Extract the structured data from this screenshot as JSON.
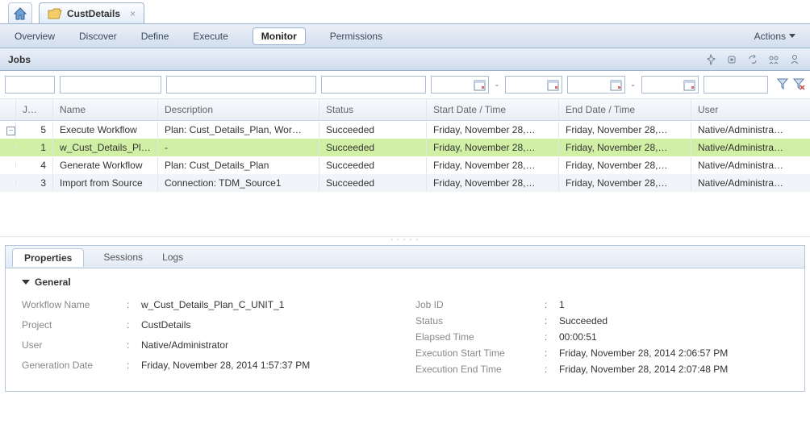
{
  "tabs": {
    "custdetails": "CustDetails"
  },
  "subnav": {
    "overview": "Overview",
    "discover": "Discover",
    "define": "Define",
    "execute": "Execute",
    "monitor": "Monitor",
    "permissions": "Permissions",
    "actions": "Actions"
  },
  "jobs_header": "Jobs",
  "grid": {
    "headers": {
      "job_id": "Job ID",
      "name": "Name",
      "description": "Description",
      "status": "Status",
      "start": "Start Date / Time",
      "end": "End Date / Time",
      "user": "User"
    },
    "rows": [
      {
        "id": "5",
        "name": "Execute Workflow",
        "desc": "Plan: Cust_Details_Plan, Wor…",
        "status": "Succeeded",
        "start": "Friday, November 28,…",
        "end": "Friday, November 28,…",
        "user": "Native/Administra…",
        "expand": true
      },
      {
        "id": "1",
        "name": "w_Cust_Details_Pl…",
        "desc": "-",
        "status": "Succeeded",
        "start": "Friday, November 28,…",
        "end": "Friday, November 28,…",
        "user": "Native/Administra…",
        "selected": true,
        "child": true
      },
      {
        "id": "4",
        "name": "Generate Workflow",
        "desc": "Plan: Cust_Details_Plan",
        "status": "Succeeded",
        "start": "Friday, November 28,…",
        "end": "Friday, November 28,…",
        "user": "Native/Administra…"
      },
      {
        "id": "3",
        "name": "Import from Source",
        "desc": "Connection: TDM_Source1",
        "status": "Succeeded",
        "start": "Friday, November 28,…",
        "end": "Friday, November 28,…",
        "user": "Native/Administra…"
      }
    ]
  },
  "lower_tabs": {
    "properties": "Properties",
    "sessions": "Sessions",
    "logs": "Logs"
  },
  "section_title": "General",
  "props_left": {
    "workflow_name_k": "Workflow Name",
    "workflow_name_v": "w_Cust_Details_Plan_C_UNIT_1",
    "project_k": "Project",
    "project_v": "CustDetails",
    "user_k": "User",
    "user_v": "Native/Administrator",
    "generation_k": "Generation Date",
    "generation_v": "Friday, November 28, 2014 1:57:37 PM"
  },
  "props_right": {
    "job_id_k": "Job ID",
    "job_id_v": "1",
    "status_k": "Status",
    "status_v": "Succeeded",
    "elapsed_k": "Elapsed Time",
    "elapsed_v": "00:00:51",
    "exec_start_k": "Execution Start Time",
    "exec_start_v": "Friday, November 28, 2014 2:06:57 PM",
    "exec_end_k": "Execution End Time",
    "exec_end_v": "Friday, November 28, 2014 2:07:48 PM"
  }
}
